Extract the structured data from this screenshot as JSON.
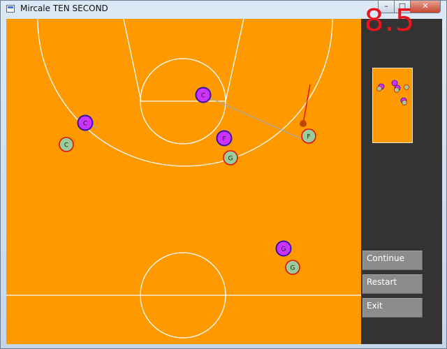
{
  "window": {
    "title": "Mircale TEN SECOND",
    "minimize_icon": "minimize-icon",
    "maximize_icon": "maximize-icon",
    "close_icon": "close-icon"
  },
  "timer": {
    "value": "8.5",
    "color": "#e8141e"
  },
  "colors": {
    "court": "#ff9900",
    "offense": "#cc33ff",
    "offense_ring": "#3311aa",
    "defense": "#99cc99",
    "defense_ring": "#dd1111",
    "ball": "#c0440a",
    "panel": "#333333",
    "button": "#8c8c8c"
  },
  "players": {
    "offense": [
      {
        "label": "C"
      },
      {
        "label": "C"
      },
      {
        "label": "F"
      },
      {
        "label": "G"
      }
    ],
    "defense": [
      {
        "label": "C"
      },
      {
        "label": "F"
      },
      {
        "label": "G"
      },
      {
        "label": "G"
      }
    ]
  },
  "menu": {
    "continue_label": "Continue",
    "restart_label": "Restart",
    "exit_label": "Exit"
  }
}
